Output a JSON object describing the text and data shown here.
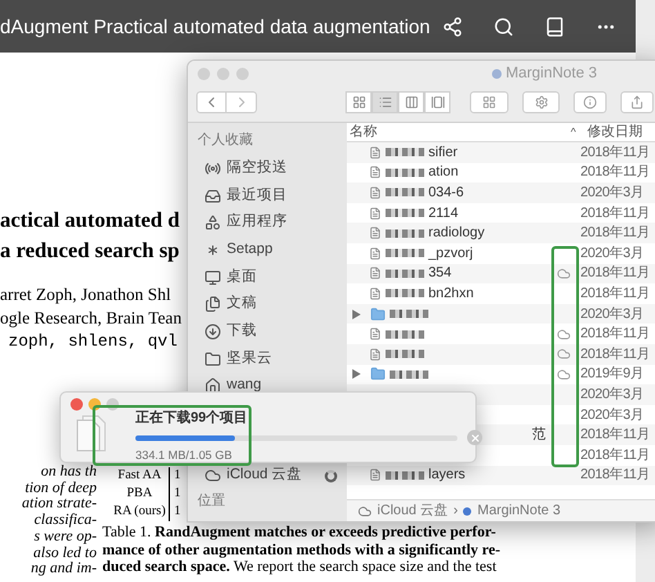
{
  "reader": {
    "title": "dAugment Practical automated data augmentation"
  },
  "paper": {
    "title_lines": [
      "actical automated d",
      "a reduced search sp"
    ],
    "authors": [
      "arret Zoph, Jonathon Shl",
      "ogle Research, Brain Tean"
    ],
    "email": "zoph, shlens, qvl",
    "body_lines": [
      "on has th",
      "tion of deep",
      "ation strate-",
      "classifica-",
      "s were op-",
      "also led to",
      "ng and im-"
    ],
    "table_rows": [
      {
        "method": "Fast AA",
        "value": "1"
      },
      {
        "method": "PBA",
        "value": "1"
      },
      {
        "method": "RA (ours)",
        "value": "1"
      }
    ],
    "caption_lines": [
      "Table 1. **RandAugment matches or exceeds predictive perfor-**",
      "**mance of other augmentation methods with a significantly re-**",
      "**duced search space.** We report the search space size and the test"
    ]
  },
  "finder": {
    "title": "MarginNote 3",
    "views": [
      {
        "selected": false
      },
      {
        "selected": true
      },
      {
        "selected": false
      },
      {
        "selected": false
      }
    ],
    "sidebar": {
      "favorites_header": "个人收藏",
      "favorites": [
        "隔空投送",
        "最近项目",
        "应用程序",
        "Setapp",
        "桌面",
        "文稿",
        "下载",
        "坚果云",
        "wang"
      ],
      "icloud": "iCloud 云盘",
      "locations_header": "位置"
    },
    "columns": {
      "name": "名称",
      "sort": "^",
      "date": "修改日期"
    },
    "files": [
      {
        "kind": "file",
        "name": "sifier",
        "date": "2018年11月",
        "cloud": false
      },
      {
        "kind": "file",
        "name": "ation",
        "date": "2018年11月",
        "cloud": false
      },
      {
        "kind": "file",
        "name": "034-6",
        "date": "2020年3月",
        "cloud": false
      },
      {
        "kind": "file",
        "name": "2114",
        "date": "2018年11月",
        "cloud": false
      },
      {
        "kind": "file",
        "name": "radiology",
        "date": "2018年11月",
        "cloud": false
      },
      {
        "kind": "file",
        "name": "_pzvorj",
        "date": "2020年3月",
        "cloud": false
      },
      {
        "kind": "file",
        "name": "354",
        "date": "2018年11月",
        "cloud": true
      },
      {
        "kind": "file",
        "name": "bn2hxn",
        "date": "2018年11月",
        "cloud": false
      },
      {
        "kind": "folder",
        "date": "2020年3月",
        "cloud": false
      },
      {
        "kind": "file",
        "date": "2018年11月",
        "cloud": true
      },
      {
        "kind": "file",
        "date": "2018年11月",
        "cloud": true
      },
      {
        "kind": "folder",
        "date": "2019年9月",
        "cloud": true
      },
      {
        "kind": "hidden",
        "date": "2020年3月",
        "cloud": false
      },
      {
        "kind": "hidden",
        "date": "2020年3月",
        "cloud": false
      },
      {
        "kind": "partial",
        "name": "范",
        "date": "2018年11月",
        "cloud": false
      },
      {
        "kind": "hidden",
        "date": "2018年11月",
        "cloud": false
      },
      {
        "kind": "file",
        "name": "layers",
        "date": "2018年11月",
        "cloud": false
      }
    ],
    "path": [
      "iCloud 云盘",
      "›",
      "MarginNote 3"
    ]
  },
  "download": {
    "title": "正在下载99个项目",
    "level": 0.31,
    "reading": "334.1 MB/1.05 GB"
  }
}
